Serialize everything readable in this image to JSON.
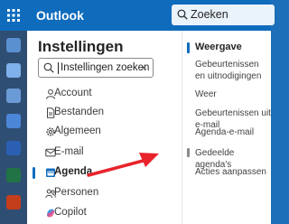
{
  "app": {
    "name": "Outlook"
  },
  "header": {
    "search_label": "Zoeken"
  },
  "dialog": {
    "title": "Instellingen",
    "search": {
      "value": "Instellingen zoeken"
    },
    "nav": [
      {
        "label": "Account",
        "icon": "person-icon"
      },
      {
        "label": "Bestanden",
        "icon": "document-icon"
      },
      {
        "label": "Algemeen",
        "icon": "gear-icon"
      },
      {
        "label": "E-mail",
        "icon": "mail-icon"
      },
      {
        "label": "Agenda",
        "icon": "calendar-icon",
        "active": true
      },
      {
        "label": "Personen",
        "icon": "people-icon"
      },
      {
        "label": "Copilot",
        "icon": "copilot-icon"
      }
    ],
    "sub_heading": "Weergave",
    "sub_items": [
      "Gebeurtenissen en uitnodigingen",
      "Weer",
      "Gebeurtenissen uit e-mail",
      "Agenda-e-mail",
      "Gedeelde agenda's",
      "Acties aanpassen"
    ]
  },
  "colors": {
    "brand": "#0f6cbd",
    "annotation_arrow": "#e8232b"
  }
}
